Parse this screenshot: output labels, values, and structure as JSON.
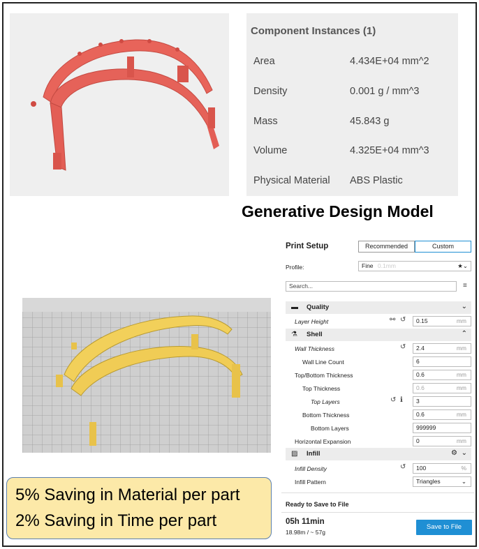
{
  "properties": {
    "title": "Component Instances (1)",
    "rows": [
      {
        "label": "Area",
        "value": "4.434E+04 mm^2"
      },
      {
        "label": "Density",
        "value": "0.001 g / mm^3"
      },
      {
        "label": "Mass",
        "value": "45.843 g"
      },
      {
        "label": "Volume",
        "value": "4.325E+04 mm^3"
      },
      {
        "label": "Physical Material",
        "value": "ABS Plastic"
      }
    ]
  },
  "heading": "Generative Design Model",
  "savings": {
    "line1": "5% Saving in Material per part",
    "line2": "2% Saving in Time per part"
  },
  "print_setup": {
    "title": "Print Setup",
    "modes": {
      "recommended": "Recommended",
      "custom": "Custom"
    },
    "profile_label": "Profile:",
    "profile_value": "Fine",
    "profile_hint": "0.1mm",
    "search_placeholder": "Search...",
    "sections": {
      "quality": "Quality",
      "shell": "Shell",
      "infill": "Infill"
    },
    "settings": {
      "layer_height": {
        "label": "Layer Height",
        "value": "0.15",
        "unit": "mm"
      },
      "wall_thickness": {
        "label": "Wall Thickness",
        "value": "2.4",
        "unit": "mm"
      },
      "wall_line_count": {
        "label": "Wall Line Count",
        "value": "6"
      },
      "top_bottom_thickness": {
        "label": "Top/Bottom Thickness",
        "value": "0.6",
        "unit": "mm"
      },
      "top_thickness": {
        "label": "Top Thickness",
        "value": "0.6",
        "unit": "mm"
      },
      "top_layers": {
        "label": "Top Layers",
        "value": "3"
      },
      "bottom_thickness": {
        "label": "Bottom Thickness",
        "value": "0.6",
        "unit": "mm"
      },
      "bottom_layers": {
        "label": "Bottom Layers",
        "value": "999999"
      },
      "horizontal_expansion": {
        "label": "Horizontal Expansion",
        "value": "0",
        "unit": "mm"
      },
      "infill_density": {
        "label": "Infill Density",
        "value": "100",
        "unit": "%"
      },
      "infill_pattern": {
        "label": "Infill Pattern",
        "value": "Triangles"
      }
    },
    "ready_label": "Ready to Save to File",
    "print_time": "05h 11min",
    "material_usage": "18.98m / ~ 57g",
    "save_label": "Save to File"
  },
  "colors": {
    "accent": "#1f8fd4",
    "red_model": "#e8645a",
    "yellow_model": "#f2d05a",
    "savings_bg": "#fce9a8"
  }
}
